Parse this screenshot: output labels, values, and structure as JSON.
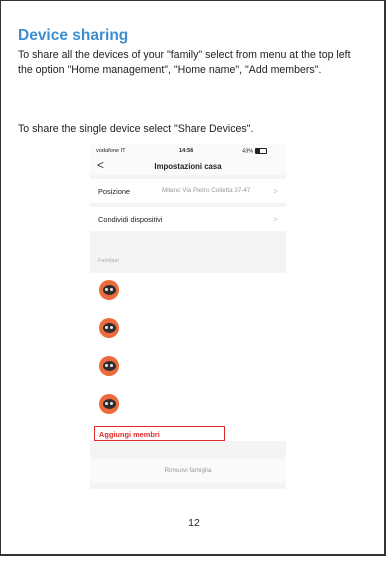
{
  "doc": {
    "title": "Device sharing",
    "para1": "To share all the devices of your \"family\" select from menu at the top left the option \"Home management\", \"Home name\", \"Add members\".",
    "para2": "To share the single device select \"Share Devices\".",
    "page_number": "12"
  },
  "phone": {
    "status": {
      "carrier": "vodafone IT",
      "time": "14:56",
      "battery": "43%"
    },
    "nav": {
      "back": "<",
      "title": "Impostazioni casa"
    },
    "rows": {
      "position_label": "Posizione",
      "position_value": "Milano Via Pietro Colletta 37-47",
      "share_label": "Condividi dispositivi",
      "chevron": ">"
    },
    "section_label": "Familiari",
    "add_members": "Aggiungi membri",
    "remove_family": "Rimuovi famiglia",
    "highlight_color": "#e02a2a",
    "avatar_color": "#ec6b3a"
  }
}
